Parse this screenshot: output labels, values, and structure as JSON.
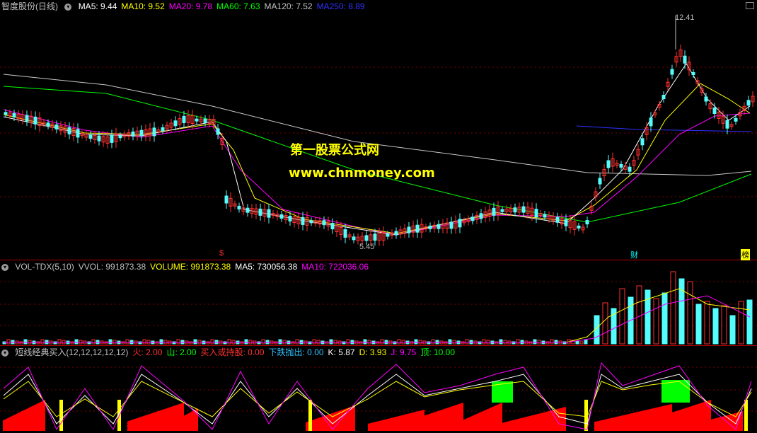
{
  "main": {
    "title": "智度股份(日线)",
    "ma_items": [
      {
        "label": "MA5: 9.44",
        "color": "#ffffff"
      },
      {
        "label": "MA10: 9.52",
        "color": "#ffff00"
      },
      {
        "label": "MA20: 9.78",
        "color": "#ff00ff"
      },
      {
        "label": "MA60: 7.63",
        "color": "#00ff00"
      },
      {
        "label": "MA120: 7.52",
        "color": "#c0c0c0"
      },
      {
        "label": "MA250: 8.89",
        "color": "#3030ff"
      }
    ],
    "high_label": "12.41",
    "low_label": "5.45",
    "markers": [
      {
        "text": "$",
        "color": "#ff3030"
      },
      {
        "text": "财",
        "color": "#00ffff"
      },
      {
        "text": "榜",
        "color": "#ffff00"
      }
    ]
  },
  "watermark": {
    "line1": "第一股票公式网",
    "line2": "www.chnmoney.com"
  },
  "volume": {
    "items": [
      {
        "label": "VOL-TDX(5,10)",
        "color": "#c0c0c0"
      },
      {
        "label": "VVOL: 991873.38",
        "color": "#c0c0c0"
      },
      {
        "label": "VOLUME: 991873.38",
        "color": "#ffff00"
      },
      {
        "label": "MA5: 730056.38",
        "color": "#ffffff"
      },
      {
        "label": "MA10: 722036.06",
        "color": "#ff00ff"
      }
    ]
  },
  "indicator": {
    "items": [
      {
        "label": "短线经典买入(12,12,12,12,12)",
        "color": "#c0c0c0"
      },
      {
        "label": "火: 2.00",
        "color": "#ff3030"
      },
      {
        "label": "山: 2.00",
        "color": "#00ff00"
      },
      {
        "label": "买入或持股: 0.00",
        "color": "#ff3030"
      },
      {
        "label": "下跌抛出: 0.00",
        "color": "#30c0ff"
      },
      {
        "label": "K: 5.87",
        "color": "#ffffff"
      },
      {
        "label": "D: 3.93",
        "color": "#ffff00"
      },
      {
        "label": "J: 9.75",
        "color": "#ff00ff"
      },
      {
        "label": "顶: 10.00",
        "color": "#00ff00"
      }
    ]
  },
  "colors": {
    "up": "#ff3030",
    "down": "#54fcfc",
    "grid": "#800000",
    "border": "#b00000"
  }
}
